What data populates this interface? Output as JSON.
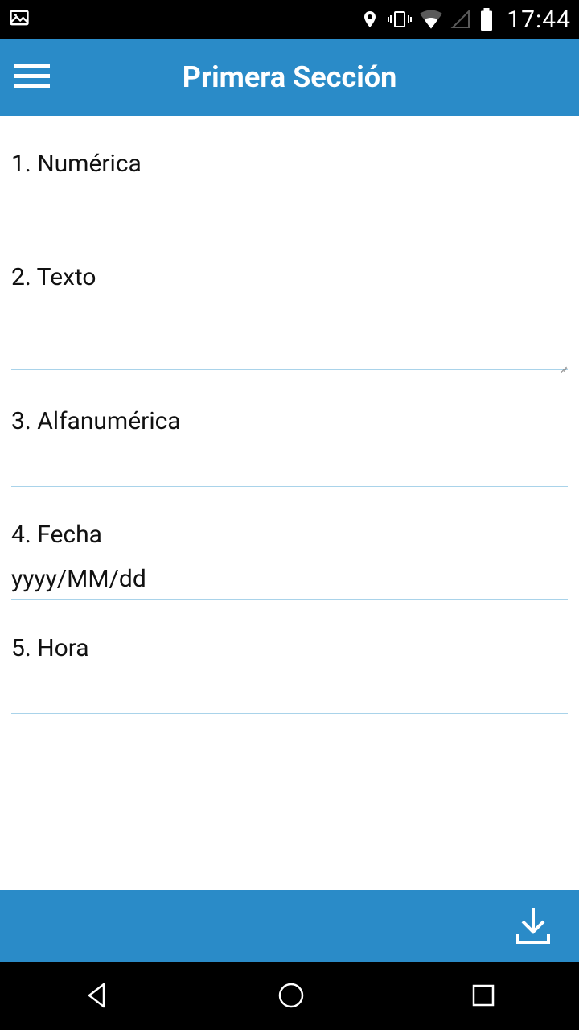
{
  "status": {
    "time": "17:44"
  },
  "header": {
    "title": "Primera Sección"
  },
  "fields": [
    {
      "label": "1. Numérica",
      "type": "text",
      "value": "",
      "placeholder": ""
    },
    {
      "label": "2. Texto",
      "type": "textarea",
      "value": "",
      "placeholder": ""
    },
    {
      "label": "3. Alfanumérica",
      "type": "text",
      "value": "",
      "placeholder": ""
    },
    {
      "label": "4. Fecha",
      "type": "text",
      "value": "",
      "placeholder": "yyyy/MM/dd"
    },
    {
      "label": "5. Hora",
      "type": "text",
      "value": "",
      "placeholder": ""
    }
  ]
}
